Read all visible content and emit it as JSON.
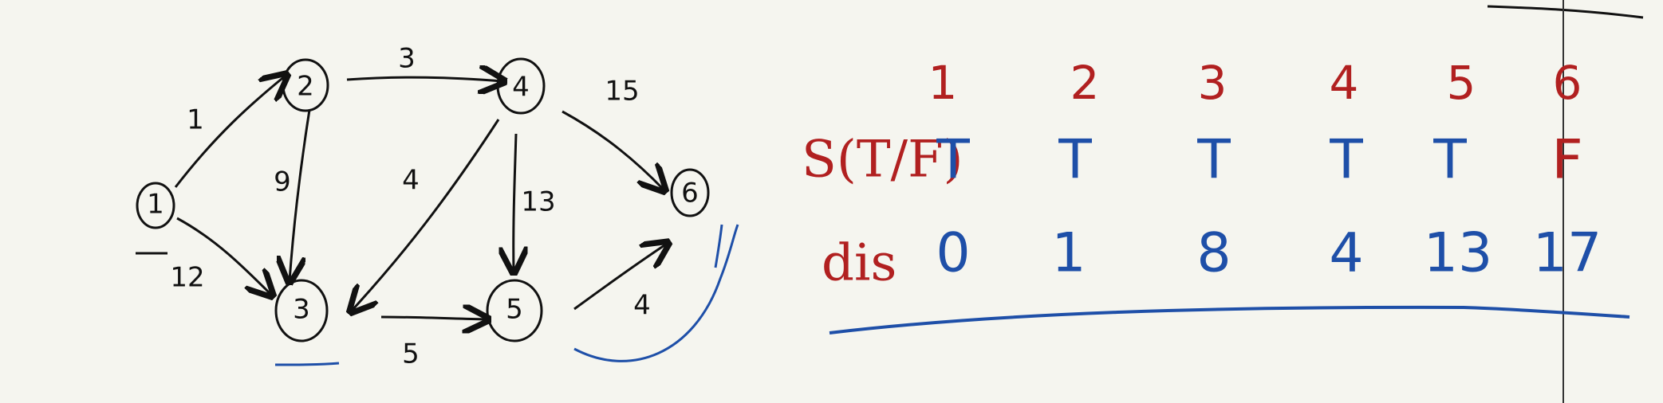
{
  "graph": {
    "nodes": [
      {
        "id": "1",
        "label": "1"
      },
      {
        "id": "2",
        "label": "2"
      },
      {
        "id": "3",
        "label": "3"
      },
      {
        "id": "4",
        "label": "4"
      },
      {
        "id": "5",
        "label": "5"
      },
      {
        "id": "6",
        "label": "6"
      }
    ],
    "edges": [
      {
        "from": "1",
        "to": "2",
        "weight": "1"
      },
      {
        "from": "1",
        "to": "3",
        "weight": "12"
      },
      {
        "from": "2",
        "to": "3",
        "weight": "9"
      },
      {
        "from": "2",
        "to": "4",
        "weight": "3"
      },
      {
        "from": "4",
        "to": "3",
        "weight": "4"
      },
      {
        "from": "4",
        "to": "5",
        "weight": "13"
      },
      {
        "from": "4",
        "to": "6",
        "weight": "15"
      },
      {
        "from": "3",
        "to": "5",
        "weight": "5"
      },
      {
        "from": "5",
        "to": "6",
        "weight": "4"
      }
    ]
  },
  "table": {
    "headers": [
      "1",
      "2",
      "3",
      "4",
      "5",
      "6"
    ],
    "row_labels": {
      "s": "S(T/F)",
      "dis": "dis"
    },
    "s_values": [
      "T",
      "T",
      "T",
      "T",
      "T",
      "F"
    ],
    "dis_values": [
      "0",
      "1",
      "8",
      "4",
      "13",
      "17"
    ]
  },
  "colors": {
    "ink": "#111111",
    "red": "#b12020",
    "blue": "#1e4fa8",
    "paper": "#f5f5ef"
  }
}
